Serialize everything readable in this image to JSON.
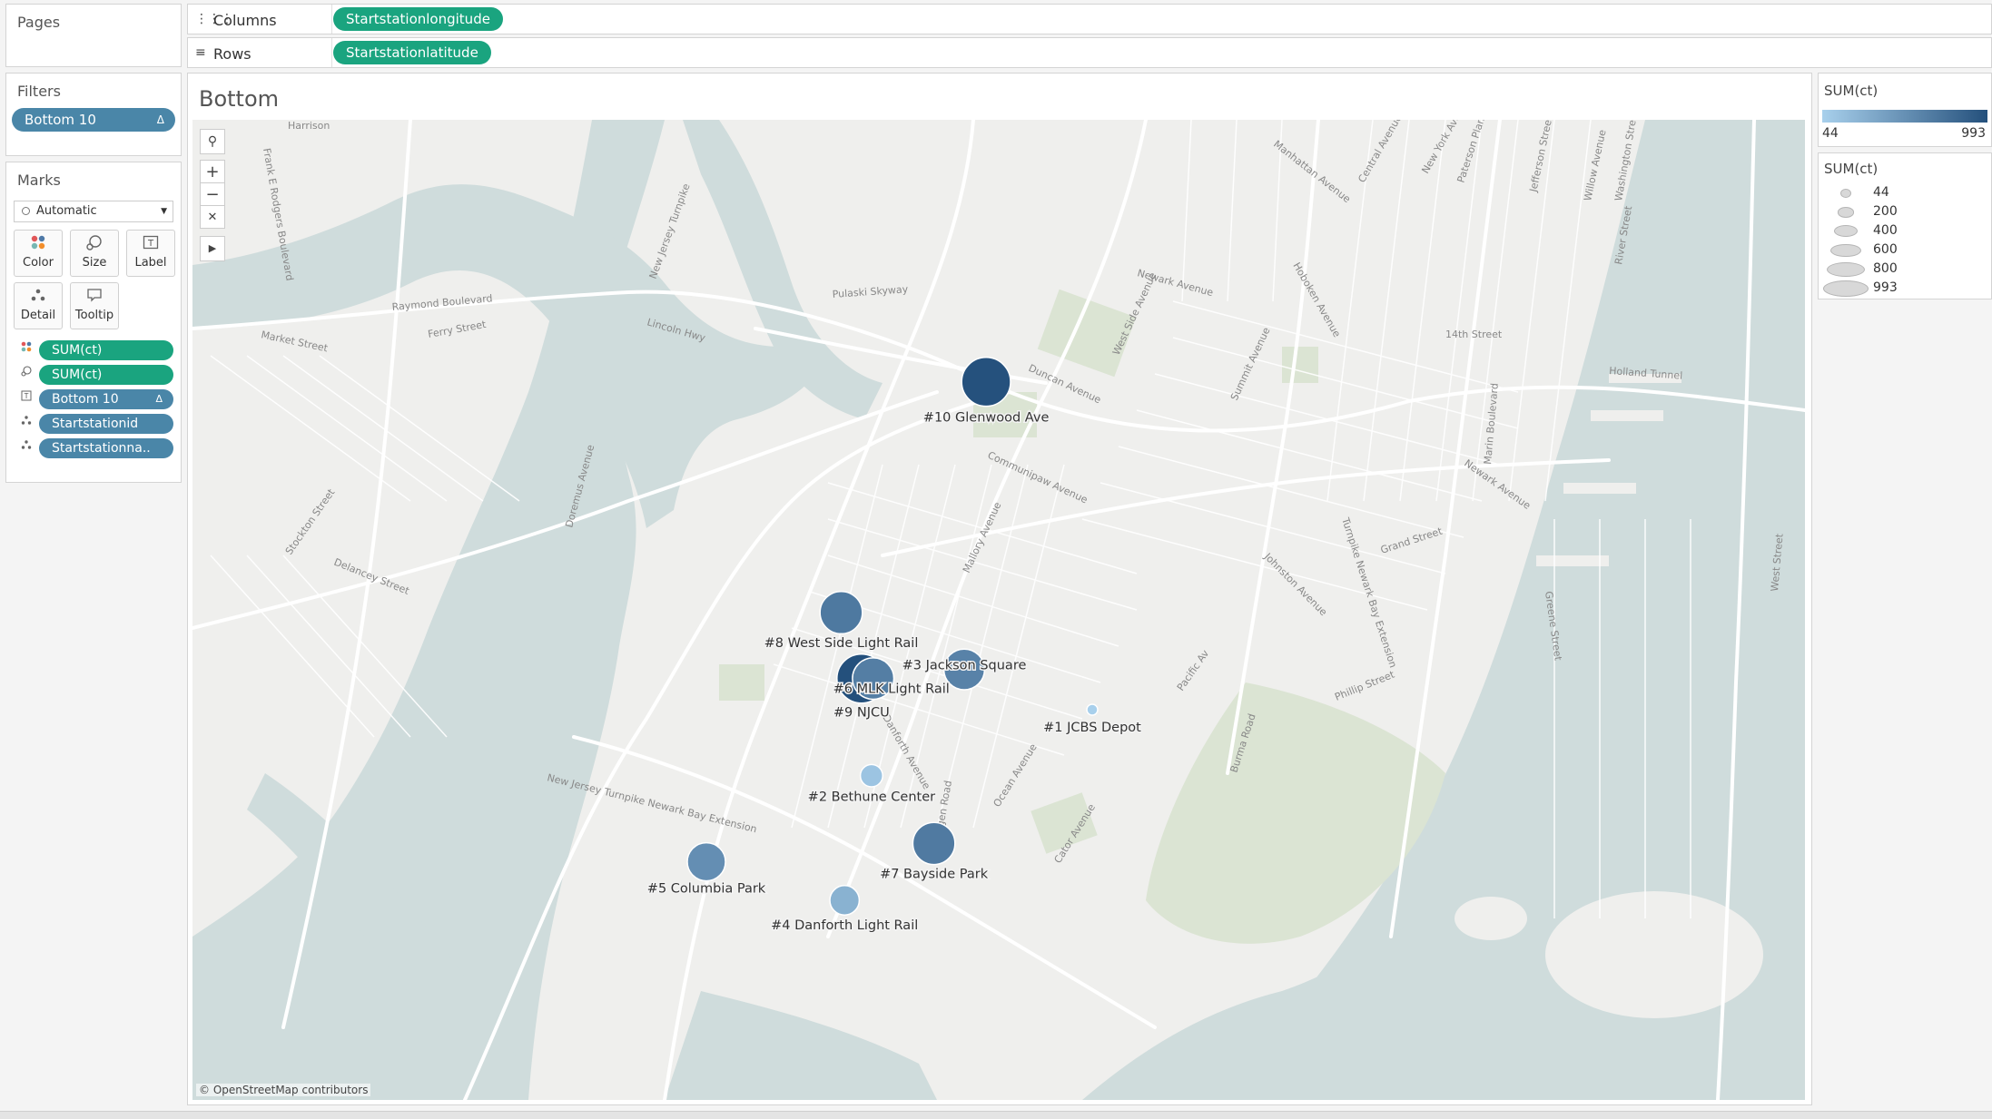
{
  "pages_panel": {
    "title": "Pages"
  },
  "columns_shelf": {
    "icon": "columns-icon",
    "label": "Columns",
    "pill": "Startstationlongitude"
  },
  "rows_shelf": {
    "icon": "rows-icon",
    "label": "Rows",
    "pill": "Startstationlatitude"
  },
  "filters_panel": {
    "title": "Filters",
    "pills": [
      {
        "label": "Bottom 10",
        "delta": "Δ"
      }
    ]
  },
  "marks_panel": {
    "title": "Marks",
    "mark_type": "Automatic",
    "buttons": [
      {
        "label": "Color",
        "icon": "color-icon"
      },
      {
        "label": "Size",
        "icon": "size-icon"
      },
      {
        "label": "Label",
        "icon": "label-icon"
      },
      {
        "label": "Detail",
        "icon": "detail-icon"
      },
      {
        "label": "Tooltip",
        "icon": "tooltip-icon"
      }
    ],
    "pills": [
      {
        "icon": "color-icon",
        "label": "SUM(ct)",
        "color": "#1aa47f",
        "delta": ""
      },
      {
        "icon": "size-icon",
        "label": "SUM(ct)",
        "color": "#1aa47f",
        "delta": ""
      },
      {
        "icon": "label-icon",
        "label": "Bottom 10",
        "color": "#4a86a8",
        "delta": "Δ"
      },
      {
        "icon": "detail-icon",
        "label": "Startstationid",
        "color": "#4a86a8",
        "delta": ""
      },
      {
        "icon": "detail-icon",
        "label": "Startstationna..",
        "color": "#4a86a8",
        "delta": ""
      }
    ]
  },
  "worksheet": {
    "title": "Bottom",
    "attribution": "© OpenStreetMap contributors",
    "map_controls": [
      "search-icon",
      "zoom-in-icon",
      "zoom-out-icon",
      "pin-icon",
      "expand-arrow-icon"
    ]
  },
  "color_legend": {
    "title": "SUM(ct)",
    "min": "44",
    "max": "993",
    "color_low": "#a8d0ec",
    "color_high": "#24507c"
  },
  "size_legend": {
    "title": "SUM(ct)",
    "values": [
      "44",
      "200",
      "400",
      "600",
      "800",
      "993"
    ]
  },
  "map_streets": [
    "Manhattan Avenue",
    "Central Avenue",
    "New York Ave",
    "Paterson Plank",
    "Jefferson Street",
    "Willow Avenue",
    "Washington Street",
    "River Street",
    "Newark Avenue",
    "Hoboken Avenue",
    "14th Street",
    "Holland Tunnel",
    "Duncan Avenue",
    "West Side Avenue",
    "Summit Avenue",
    "Communipaw Avenue",
    "Grand Street",
    "Newark Avenue",
    "Raymond Boulevard",
    "Ferry Street",
    "Market Street",
    "Lincoln Hwy",
    "Pulaski Skyway",
    "Delancey Street",
    "Stockton Street",
    "Doremus Avenue",
    "New Jersey Turnpike",
    "Frank E Rodgers Boulevard",
    "Harrison",
    "Danforth Avenue",
    "Ocean Avenue",
    "Phillip Street",
    "Burma Road",
    "Mallory Avenue",
    "Pacific Av",
    "Johnston Avenue",
    "Marin Boulevard",
    "Greene Street",
    "West Street",
    "New Jersey Turnpike Newark Bay Extension",
    "Turnpike Newark Bay Extension",
    "Old Bergen Road",
    "Cator Avenue"
  ],
  "chart_data": {
    "type": "scatter",
    "title": "Bottom",
    "xlabel": "Startstationlongitude",
    "ylabel": "Startstationlatitude",
    "color_measure": "SUM(ct)",
    "size_measure": "SUM(ct)",
    "size_range": [
      44,
      993
    ],
    "points": [
      {
        "label": "#1 JCBS Depot",
        "lon": -74.0733,
        "lat": 40.7093,
        "ct": 44
      },
      {
        "label": "#2 Bethune Center",
        "lon": -74.0864,
        "lat": 40.7057,
        "ct": 130
      },
      {
        "label": "#3 Jackson Square",
        "lon": -74.0809,
        "lat": 40.7115,
        "ct": 620
      },
      {
        "label": "#4 Danforth Light Rail",
        "lon": -74.088,
        "lat": 40.6989,
        "ct": 270
      },
      {
        "label": "#5 Columbia Park",
        "lon": -74.0962,
        "lat": 40.701,
        "ct": 530
      },
      {
        "label": "#6 MLK Light Rail",
        "lon": -74.0863,
        "lat": 40.711,
        "ct": 650
      },
      {
        "label": "#7 Bayside Park",
        "lon": -74.0827,
        "lat": 40.702,
        "ct": 680
      },
      {
        "label": "#8 West Side Light Rail",
        "lon": -74.0882,
        "lat": 40.7146,
        "ct": 690
      },
      {
        "label": "#9 NJCU",
        "lon": -74.087,
        "lat": 40.711,
        "ct": 993
      },
      {
        "label": "#10 Glenwood Ave",
        "lon": -74.0796,
        "lat": 40.7272,
        "ct": 985
      }
    ]
  }
}
